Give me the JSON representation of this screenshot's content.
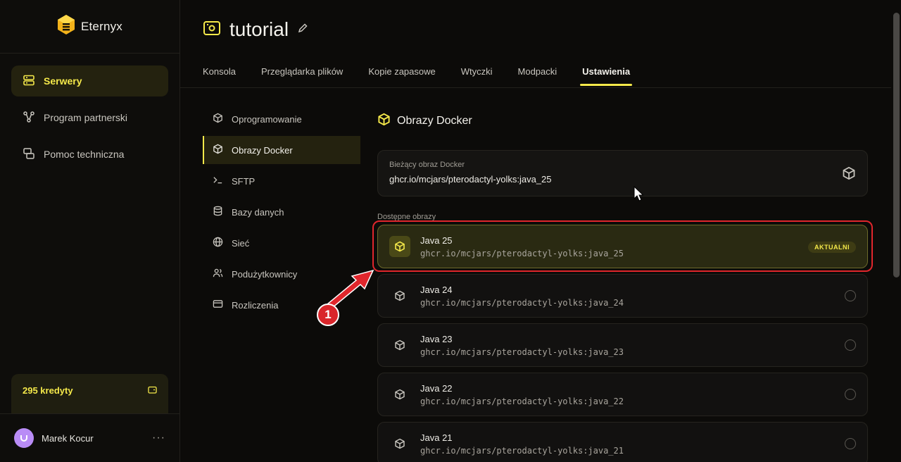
{
  "app": {
    "brand": "Eternyx"
  },
  "sidebar": {
    "items": [
      {
        "label": "Serwery",
        "icon": "server-icon",
        "active": true
      },
      {
        "label": "Program partnerski",
        "icon": "network-icon",
        "active": false
      },
      {
        "label": "Pomoc techniczna",
        "icon": "support-icon",
        "active": false
      }
    ],
    "credits": "295 kredyty",
    "user": {
      "name": "Marek Kocur",
      "menu": "···"
    }
  },
  "header": {
    "title": "tutorial",
    "tabs": [
      {
        "label": "Konsola"
      },
      {
        "label": "Przeglądarka plików"
      },
      {
        "label": "Kopie zapasowe"
      },
      {
        "label": "Wtyczki"
      },
      {
        "label": "Modpacki"
      },
      {
        "label": "Ustawienia",
        "active": true
      }
    ]
  },
  "settings_nav": [
    {
      "label": "Oprogramowanie",
      "icon": "package-icon"
    },
    {
      "label": "Obrazy Docker",
      "icon": "box-icon",
      "active": true
    },
    {
      "label": "SFTP",
      "icon": "terminal-icon"
    },
    {
      "label": "Bazy danych",
      "icon": "database-icon"
    },
    {
      "label": "Sieć",
      "icon": "globe-icon"
    },
    {
      "label": "Podużytkownicy",
      "icon": "users-icon"
    },
    {
      "label": "Rozliczenia",
      "icon": "card-icon"
    }
  ],
  "docker": {
    "section_title": "Obrazy Docker",
    "current_label": "Bieżący obraz Docker",
    "current_value": "ghcr.io/mcjars/pterodactyl-yolks:java_25",
    "available_label": "Dostępne obrazy",
    "images": [
      {
        "name": "Java 25",
        "path": "ghcr.io/mcjars/pterodactyl-yolks:java_25",
        "badge": "AKTUALNI"
      },
      {
        "name": "Java 24",
        "path": "ghcr.io/mcjars/pterodactyl-yolks:java_24"
      },
      {
        "name": "Java 23",
        "path": "ghcr.io/mcjars/pterodactyl-yolks:java_23"
      },
      {
        "name": "Java 22",
        "path": "ghcr.io/mcjars/pterodactyl-yolks:java_22"
      },
      {
        "name": "Java 21",
        "path": "ghcr.io/mcjars/pterodactyl-yolks:java_21"
      }
    ]
  },
  "annotation": {
    "number": "1"
  },
  "colors": {
    "accent": "#f5e94a",
    "annotation": "#e0262c",
    "background": "#0c0b09"
  }
}
